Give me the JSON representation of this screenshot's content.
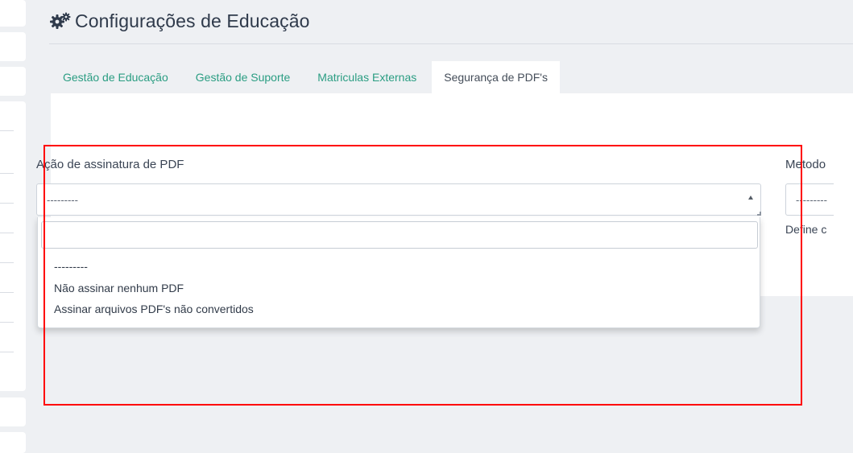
{
  "page": {
    "title": "Configurações de Educação",
    "title_icon": "gears-icon"
  },
  "tabs": [
    {
      "label": "Gestão de Educação",
      "active": false
    },
    {
      "label": "Gestão de Suporte",
      "active": false
    },
    {
      "label": "Matriculas Externas",
      "active": false
    },
    {
      "label": "Segurança de PDF's",
      "active": true
    }
  ],
  "field_sign_action": {
    "label": "Ação de assinatura de PDF",
    "selected": "---------",
    "search_value": "",
    "options": [
      "---------",
      "Não assinar nenhum PDF",
      "Assinar arquivos PDF's não convertidos"
    ]
  },
  "field_method": {
    "label": "Metodo",
    "selected": "---------",
    "help_text": "Define c"
  },
  "colors": {
    "tab_link": "#2a9d82",
    "highlight": "#ff0000",
    "background": "#eef0f3"
  }
}
